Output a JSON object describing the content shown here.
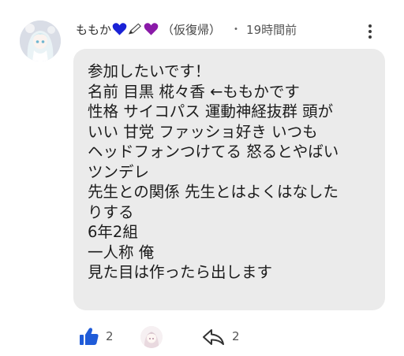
{
  "comment": {
    "author": "ももか",
    "author_emojis": [
      "blue-heart",
      "pen",
      "purple-heart"
    ],
    "status": "（仮復帰）",
    "separator": "・",
    "time": "19時間前",
    "lines": [
      "参加したいです！",
      "名前 目黒 椛々香 ←ももかです",
      "性格 サイコパス 運動神経抜群 頭が",
      "いい 甘党 ファッショ好き いつも",
      "ヘッドフォンつけてる 怒るとやばい",
      "ツンデレ",
      "先生との関係 先生とはよくはなした",
      "りする",
      "6年2組",
      "一人称 俺",
      "見た目は作ったら出します"
    ],
    "likes": "2",
    "shares": "2"
  },
  "icons": [
    "avatar",
    "more-icon",
    "like-icon",
    "reactor-avatar",
    "share-icon"
  ],
  "colors": {
    "like_blue": "#1f5bd8",
    "blue_heart": "#1a22d6",
    "purple_heart": "#8a1aa8",
    "bubble": "#ebebeb"
  }
}
